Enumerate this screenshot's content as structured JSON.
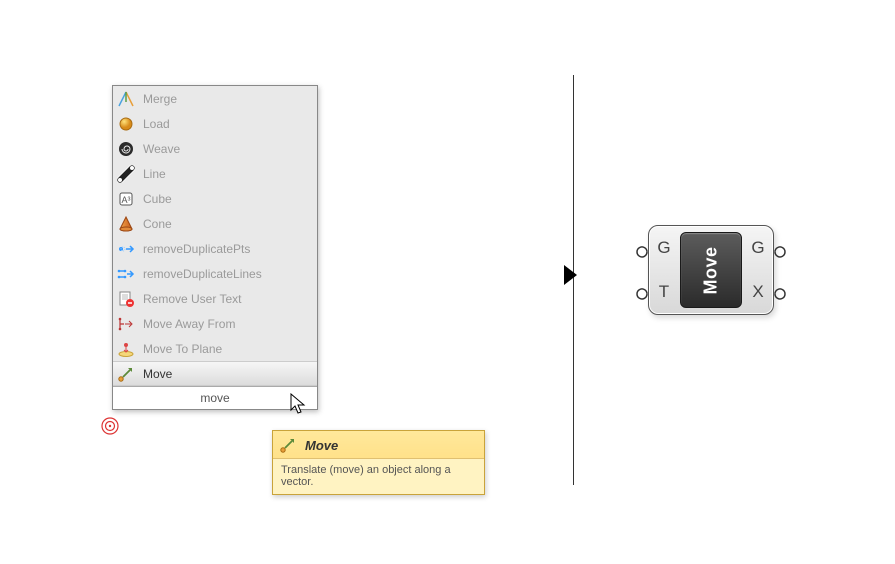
{
  "menu": {
    "items": [
      {
        "label": "Merge",
        "icon": "merge"
      },
      {
        "label": "Load",
        "icon": "sphere-orange"
      },
      {
        "label": "Weave",
        "icon": "spiral"
      },
      {
        "label": "Line",
        "icon": "line-node"
      },
      {
        "label": "Cube",
        "icon": "cube-a"
      },
      {
        "label": "Cone",
        "icon": "cone"
      },
      {
        "label": "removeDuplicatePts",
        "icon": "dup-pts"
      },
      {
        "label": "removeDuplicateLines",
        "icon": "dup-lines"
      },
      {
        "label": "Remove User Text",
        "icon": "remove-text"
      },
      {
        "label": "Move Away From",
        "icon": "move-away"
      },
      {
        "label": "Move To Plane",
        "icon": "move-plane"
      },
      {
        "label": "Move",
        "icon": "move-arrow",
        "selected": true
      }
    ],
    "search_value": "move"
  },
  "tooltip": {
    "title": "Move",
    "body": "Translate (move) an object along a vector."
  },
  "component": {
    "name": "Move",
    "inputs": [
      "G",
      "T"
    ],
    "outputs": [
      "G",
      "X"
    ]
  }
}
